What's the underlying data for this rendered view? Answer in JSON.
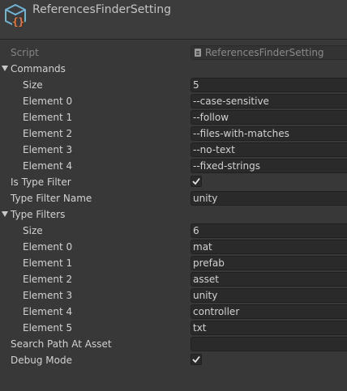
{
  "header": {
    "title": "ReferencesFinderSetting"
  },
  "script": {
    "label": "Script",
    "value": "ReferencesFinderSetting"
  },
  "commands": {
    "label": "Commands",
    "size_label": "Size",
    "size": "5",
    "elements": [
      {
        "label": "Element 0",
        "value": "--case-sensitive"
      },
      {
        "label": "Element 1",
        "value": "--follow"
      },
      {
        "label": "Element 2",
        "value": "--files-with-matches"
      },
      {
        "label": "Element 3",
        "value": "--no-text"
      },
      {
        "label": "Element 4",
        "value": "--fixed-strings"
      }
    ]
  },
  "is_type_filter": {
    "label": "Is Type Filter",
    "checked": true
  },
  "type_filter_name": {
    "label": "Type Filter Name",
    "value": "unity"
  },
  "type_filters": {
    "label": "Type Filters",
    "size_label": "Size",
    "size": "6",
    "elements": [
      {
        "label": "Element 0",
        "value": "mat"
      },
      {
        "label": "Element 1",
        "value": "prefab"
      },
      {
        "label": "Element 2",
        "value": "asset"
      },
      {
        "label": "Element 3",
        "value": "unity"
      },
      {
        "label": "Element 4",
        "value": "controller"
      },
      {
        "label": "Element 5",
        "value": "txt"
      }
    ]
  },
  "search_path_at_asset": {
    "label": "Search Path At Asset",
    "value": ""
  },
  "debug_mode": {
    "label": "Debug Mode",
    "checked": true
  },
  "colors": {
    "background": "#383838",
    "field": "#2a2a2a",
    "text": "#d2d2d2",
    "disabled_text": "#858585",
    "icon_cube": "#6fb4d6",
    "icon_braces": "#f07c3a"
  }
}
